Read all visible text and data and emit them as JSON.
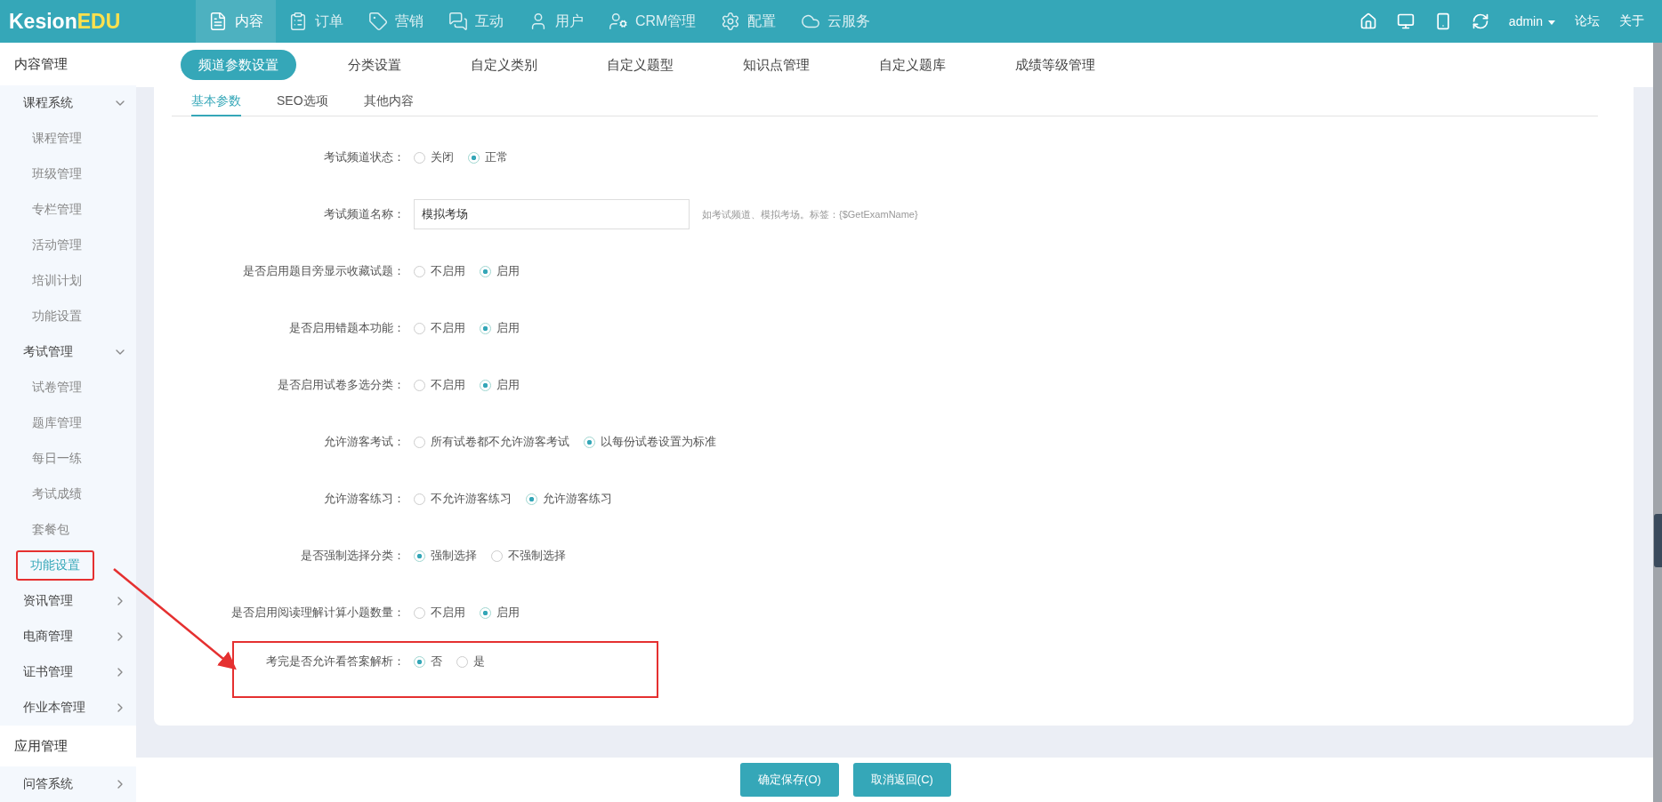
{
  "logo": {
    "name": "Kesion",
    "accent": "EDU"
  },
  "nav": [
    {
      "label": "内容",
      "selected": true
    },
    {
      "label": "订单",
      "selected": false
    },
    {
      "label": "营销",
      "selected": false
    },
    {
      "label": "互动",
      "selected": false
    },
    {
      "label": "用户",
      "selected": false
    },
    {
      "label": "CRM管理",
      "selected": false
    },
    {
      "label": "配置",
      "selected": false
    },
    {
      "label": "云服务",
      "selected": false
    }
  ],
  "user": {
    "name": "admin",
    "links": [
      "论坛",
      "关于"
    ]
  },
  "sidebar": {
    "title": "内容管理",
    "groups": [
      {
        "label": "课程系统",
        "expanded": true,
        "children": [
          {
            "label": "课程管理",
            "selected": false,
            "highlighted": false
          },
          {
            "label": "班级管理",
            "selected": false,
            "highlighted": false
          },
          {
            "label": "专栏管理",
            "selected": false,
            "highlighted": false
          },
          {
            "label": "活动管理",
            "selected": false,
            "highlighted": false
          },
          {
            "label": "培训计划",
            "selected": false,
            "highlighted": false
          },
          {
            "label": "功能设置",
            "selected": false,
            "highlighted": false
          }
        ]
      },
      {
        "label": "考试管理",
        "expanded": true,
        "children": [
          {
            "label": "试卷管理",
            "selected": false,
            "highlighted": false
          },
          {
            "label": "题库管理",
            "selected": false,
            "highlighted": false
          },
          {
            "label": "每日一练",
            "selected": false,
            "highlighted": false
          },
          {
            "label": "考试成绩",
            "selected": false,
            "highlighted": false
          },
          {
            "label": "套餐包",
            "selected": false,
            "highlighted": false
          },
          {
            "label": "功能设置",
            "selected": true,
            "highlighted": true
          }
        ]
      },
      {
        "label": "资讯管理",
        "expanded": false
      },
      {
        "label": "电商管理",
        "expanded": false
      },
      {
        "label": "证书管理",
        "expanded": false
      },
      {
        "label": "作业本管理",
        "expanded": false
      }
    ],
    "section2": {
      "title": "应用管理",
      "groups": [
        {
          "label": "问答系统",
          "expanded": false
        }
      ]
    }
  },
  "subtabs": [
    {
      "label": "频道参数设置",
      "selected": true
    },
    {
      "label": "分类设置",
      "selected": false
    },
    {
      "label": "自定义类别",
      "selected": false
    },
    {
      "label": "自定义题型",
      "selected": false
    },
    {
      "label": "知识点管理",
      "selected": false
    },
    {
      "label": "自定义题库",
      "selected": false
    },
    {
      "label": "成绩等级管理",
      "selected": false
    }
  ],
  "card_tabs": [
    {
      "label": "基本参数",
      "selected": true
    },
    {
      "label": "SEO选项",
      "selected": false
    },
    {
      "label": "其他内容",
      "selected": false
    }
  ],
  "form": [
    {
      "kind": "radio",
      "label": "考试频道状态：",
      "highlighted": false,
      "options": [
        {
          "label": "关闭",
          "selected": false
        },
        {
          "label": "正常",
          "selected": true
        }
      ]
    },
    {
      "kind": "text",
      "label": "考试频道名称：",
      "highlighted": false,
      "value": "模拟考场",
      "hint": "如考试频道、模拟考场。标签：{$GetExamName}"
    },
    {
      "kind": "radio",
      "label": "是否启用题目旁显示收藏试题：",
      "highlighted": false,
      "options": [
        {
          "label": "不启用",
          "selected": false
        },
        {
          "label": "启用",
          "selected": true
        }
      ]
    },
    {
      "kind": "radio",
      "label": "是否启用错题本功能：",
      "highlighted": false,
      "options": [
        {
          "label": "不启用",
          "selected": false
        },
        {
          "label": "启用",
          "selected": true
        }
      ]
    },
    {
      "kind": "radio",
      "label": "是否启用试卷多选分类：",
      "highlighted": false,
      "options": [
        {
          "label": "不启用",
          "selected": false
        },
        {
          "label": "启用",
          "selected": true
        }
      ]
    },
    {
      "kind": "radio",
      "label": "允许游客考试：",
      "highlighted": false,
      "options": [
        {
          "label": "所有试卷都不允许游客考试",
          "selected": false
        },
        {
          "label": "以每份试卷设置为标准",
          "selected": true
        }
      ]
    },
    {
      "kind": "radio",
      "label": "允许游客练习：",
      "highlighted": false,
      "options": [
        {
          "label": "不允许游客练习",
          "selected": false
        },
        {
          "label": "允许游客练习",
          "selected": true
        }
      ]
    },
    {
      "kind": "radio",
      "label": "是否强制选择分类：",
      "highlighted": false,
      "options": [
        {
          "label": "强制选择",
          "selected": true
        },
        {
          "label": "不强制选择",
          "selected": false
        }
      ]
    },
    {
      "kind": "radio",
      "label": "是否启用阅读理解计算小题数量：",
      "highlighted": false,
      "options": [
        {
          "label": "不启用",
          "selected": false
        },
        {
          "label": "启用",
          "selected": true
        }
      ]
    },
    {
      "kind": "radio",
      "label": "考完是否允许看答案解析：",
      "highlighted": true,
      "options": [
        {
          "label": "否",
          "selected": true
        },
        {
          "label": "是",
          "selected": false
        }
      ]
    }
  ],
  "buttons": [
    "确定保存(O)",
    "取消返回(C)"
  ]
}
